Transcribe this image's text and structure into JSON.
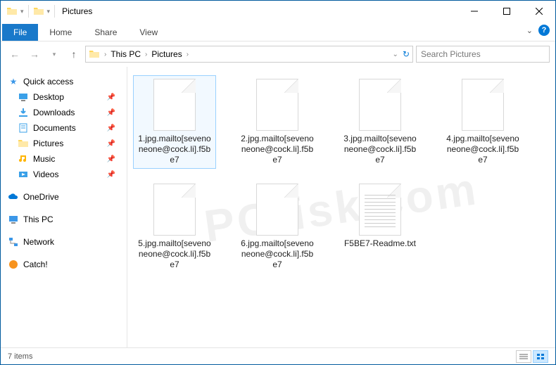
{
  "titlebar": {
    "title": "Pictures"
  },
  "ribbon": {
    "file": "File",
    "tabs": [
      "Home",
      "Share",
      "View"
    ]
  },
  "nav": {
    "crumbs": [
      "This PC",
      "Pictures"
    ],
    "search_placeholder": "Search Pictures"
  },
  "sidebar": {
    "quick_access": "Quick access",
    "quick_items": [
      {
        "label": "Desktop",
        "icon": "desktop"
      },
      {
        "label": "Downloads",
        "icon": "downloads"
      },
      {
        "label": "Documents",
        "icon": "documents"
      },
      {
        "label": "Pictures",
        "icon": "pictures"
      },
      {
        "label": "Music",
        "icon": "music"
      },
      {
        "label": "Videos",
        "icon": "videos"
      }
    ],
    "onedrive": "OneDrive",
    "thispc": "This PC",
    "network": "Network",
    "catch": "Catch!"
  },
  "files": [
    {
      "name": "1.jpg.mailto[sevenoneone@cock.li].f5be7",
      "type": "blank",
      "selected": true
    },
    {
      "name": "2.jpg.mailto[sevenoneone@cock.li].f5be7",
      "type": "blank"
    },
    {
      "name": "3.jpg.mailto[sevenoneone@cock.li].f5be7",
      "type": "blank"
    },
    {
      "name": "4.jpg.mailto[sevenoneone@cock.li].f5be7",
      "type": "blank"
    },
    {
      "name": "5.jpg.mailto[sevenoneone@cock.li].f5be7",
      "type": "blank"
    },
    {
      "name": "6.jpg.mailto[sevenoneone@cock.li].f5be7",
      "type": "blank"
    },
    {
      "name": "F5BE7-Readme.txt",
      "type": "txt"
    }
  ],
  "status": {
    "count": "7 items"
  },
  "watermark": "PCrisk.com"
}
